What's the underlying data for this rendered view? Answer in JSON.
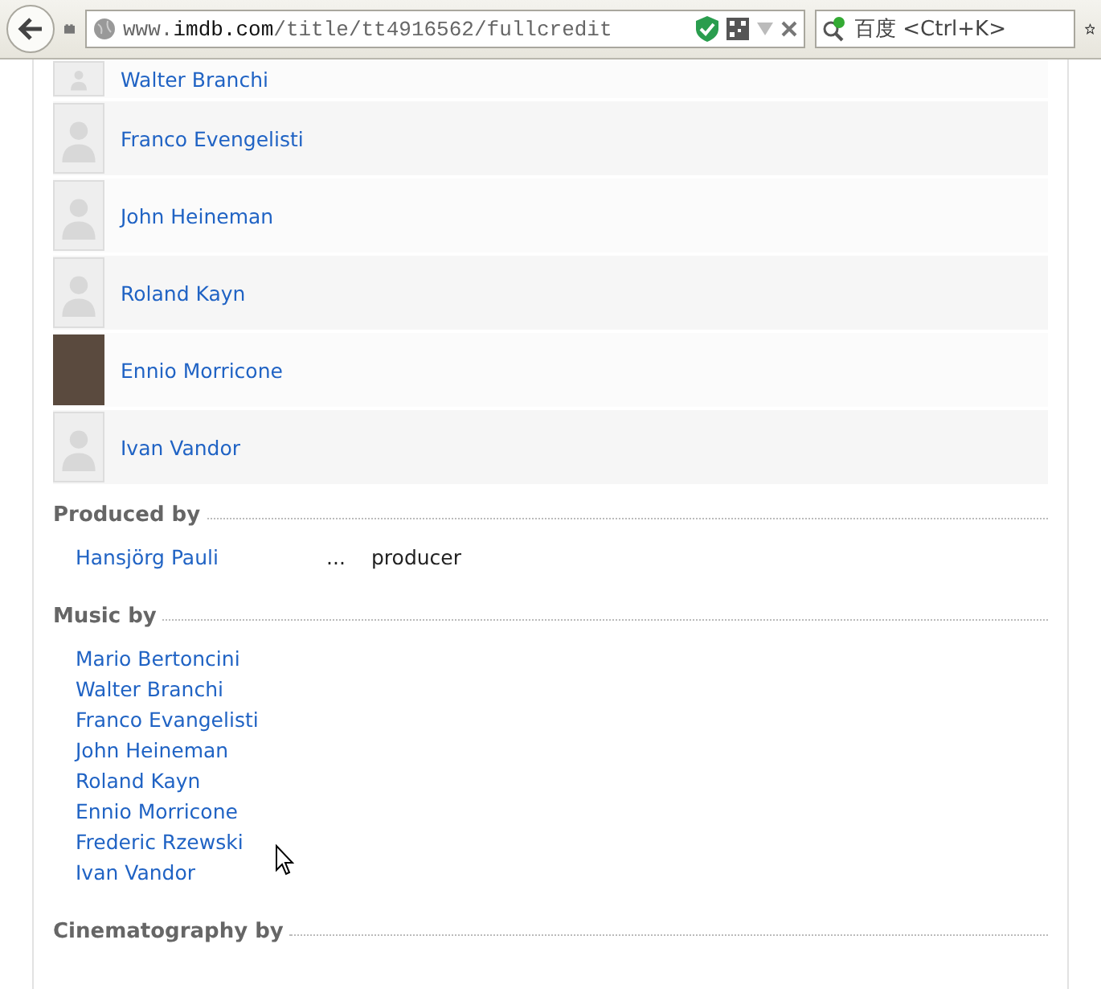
{
  "toolbar": {
    "url": "www.**imdb.com**/title/tt4916562/fullcredit",
    "search": {
      "placeholder": "百度 <Ctrl+K>"
    }
  },
  "cast_rows": [
    {
      "name": "Walter Branchi",
      "kind": "placeholder"
    },
    {
      "name": "Franco Evengelisti",
      "kind": "placeholder"
    },
    {
      "name": "John Heineman",
      "kind": "placeholder"
    },
    {
      "name": "Roland Kayn",
      "kind": "placeholder"
    },
    {
      "name": "Ennio Morricone",
      "kind": "photo"
    },
    {
      "name": "Ivan Vandor",
      "kind": "placeholder"
    }
  ],
  "sections": [
    {
      "title": "Produced by",
      "credits": [
        {
          "name": "Hansjörg Pauli",
          "dots": "...",
          "role": "producer"
        }
      ]
    },
    {
      "title": "Music by",
      "credits": [
        {
          "name": "Mario Bertoncini"
        },
        {
          "name": "Walter Branchi"
        },
        {
          "name": "Franco Evangelisti"
        },
        {
          "name": "John Heineman"
        },
        {
          "name": "Roland Kayn"
        },
        {
          "name": "Ennio Morricone"
        },
        {
          "name": "Frederic Rzewski"
        },
        {
          "name": "Ivan Vandor"
        }
      ]
    },
    {
      "title": "Cinematography by"
    }
  ]
}
